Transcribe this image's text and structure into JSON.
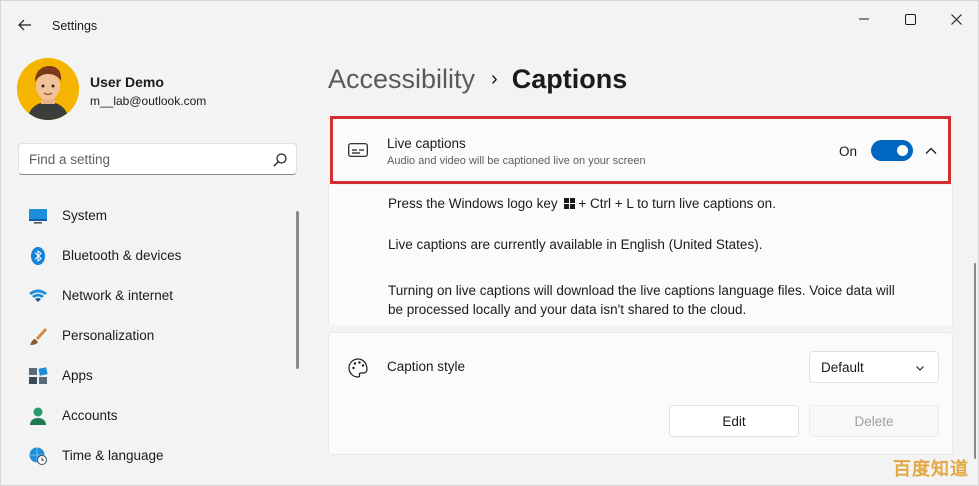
{
  "window": {
    "title": "Settings",
    "controls": {
      "minimize": "minimize-icon",
      "maximize": "maximize-icon",
      "close": "close-icon"
    }
  },
  "profile": {
    "name": "User Demo",
    "email": "m__lab@outlook.com"
  },
  "search": {
    "placeholder": "Find a setting"
  },
  "sidebar": {
    "items": [
      {
        "label": "System",
        "icon": "monitor-icon"
      },
      {
        "label": "Bluetooth & devices",
        "icon": "bluetooth-icon"
      },
      {
        "label": "Network & internet",
        "icon": "wifi-icon"
      },
      {
        "label": "Personalization",
        "icon": "brush-icon"
      },
      {
        "label": "Apps",
        "icon": "apps-icon"
      },
      {
        "label": "Accounts",
        "icon": "person-icon"
      },
      {
        "label": "Time & language",
        "icon": "globe-clock-icon"
      }
    ]
  },
  "breadcrumb": {
    "parent": "Accessibility",
    "separator": "›",
    "current": "Captions"
  },
  "live_captions": {
    "title": "Live captions",
    "subtitle": "Audio and video will be captioned live on your screen",
    "toggle_state": "On",
    "toggle_on": true,
    "details": {
      "line1_pre": "Press the Windows logo key",
      "line1_post": "+ Ctrl + L to turn live captions on.",
      "line2": "Live captions are currently available in English (United States).",
      "line3": "Turning on live captions will download the live captions language files. Voice data will be processed locally and your data isn't shared to the cloud."
    }
  },
  "caption_style": {
    "label": "Caption style",
    "selected": "Default",
    "edit_label": "Edit",
    "delete_label": "Delete"
  },
  "watermark": "百度知道",
  "colors": {
    "accent": "#0067c0",
    "highlight_border": "#d32f2f"
  }
}
